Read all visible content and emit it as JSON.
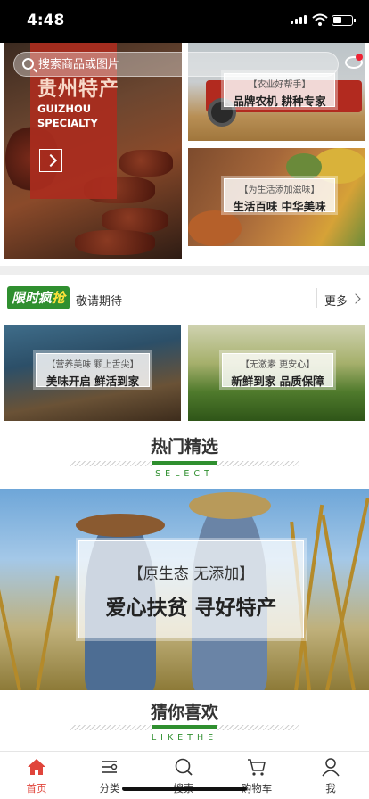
{
  "status_bar": {
    "time": "4:48"
  },
  "search": {
    "placeholder": "搜索商品或图片"
  },
  "hero": {
    "main": {
      "title": "贵州特产",
      "subtitle_line1": "GUIZHOU",
      "subtitle_line2": "SPECIALTY"
    },
    "top_right": {
      "small": "【农业好帮手】",
      "big": "品牌农机  耕种专家"
    },
    "bottom_right": {
      "small": "【为生活添加滋味】",
      "big": "生活百味  中华美味"
    }
  },
  "flash_sale": {
    "logo_part1": "限时疯",
    "logo_part2": "抢",
    "subtitle": "敬请期待",
    "more_label": "更多"
  },
  "promos": [
    {
      "small": "【营养美味 颗上舌尖】",
      "big": "美味开启  鲜活到家"
    },
    {
      "small": "【无激素 更安心】",
      "big": "新鲜到家  品质保障"
    }
  ],
  "section_hot": {
    "title": "热门精选",
    "en": "SELECT"
  },
  "banner": {
    "small": "【原生态  无添加】",
    "big": "爱心扶贫  寻好特产"
  },
  "section_like": {
    "title": "猜你喜欢",
    "en": "LIKETHE"
  },
  "tabbar": {
    "items": [
      {
        "label": "首页",
        "icon": "home-icon",
        "active": true
      },
      {
        "label": "分类",
        "icon": "category-icon",
        "active": false
      },
      {
        "label": "搜索",
        "icon": "search-icon",
        "active": false
      },
      {
        "label": "购物车",
        "icon": "cart-icon",
        "active": false
      },
      {
        "label": "我",
        "icon": "user-icon",
        "active": false
      }
    ]
  },
  "colors": {
    "accent_green": "#2f8f2f",
    "active_red": "#e0453b",
    "hero_red": "#aa2d1e"
  }
}
